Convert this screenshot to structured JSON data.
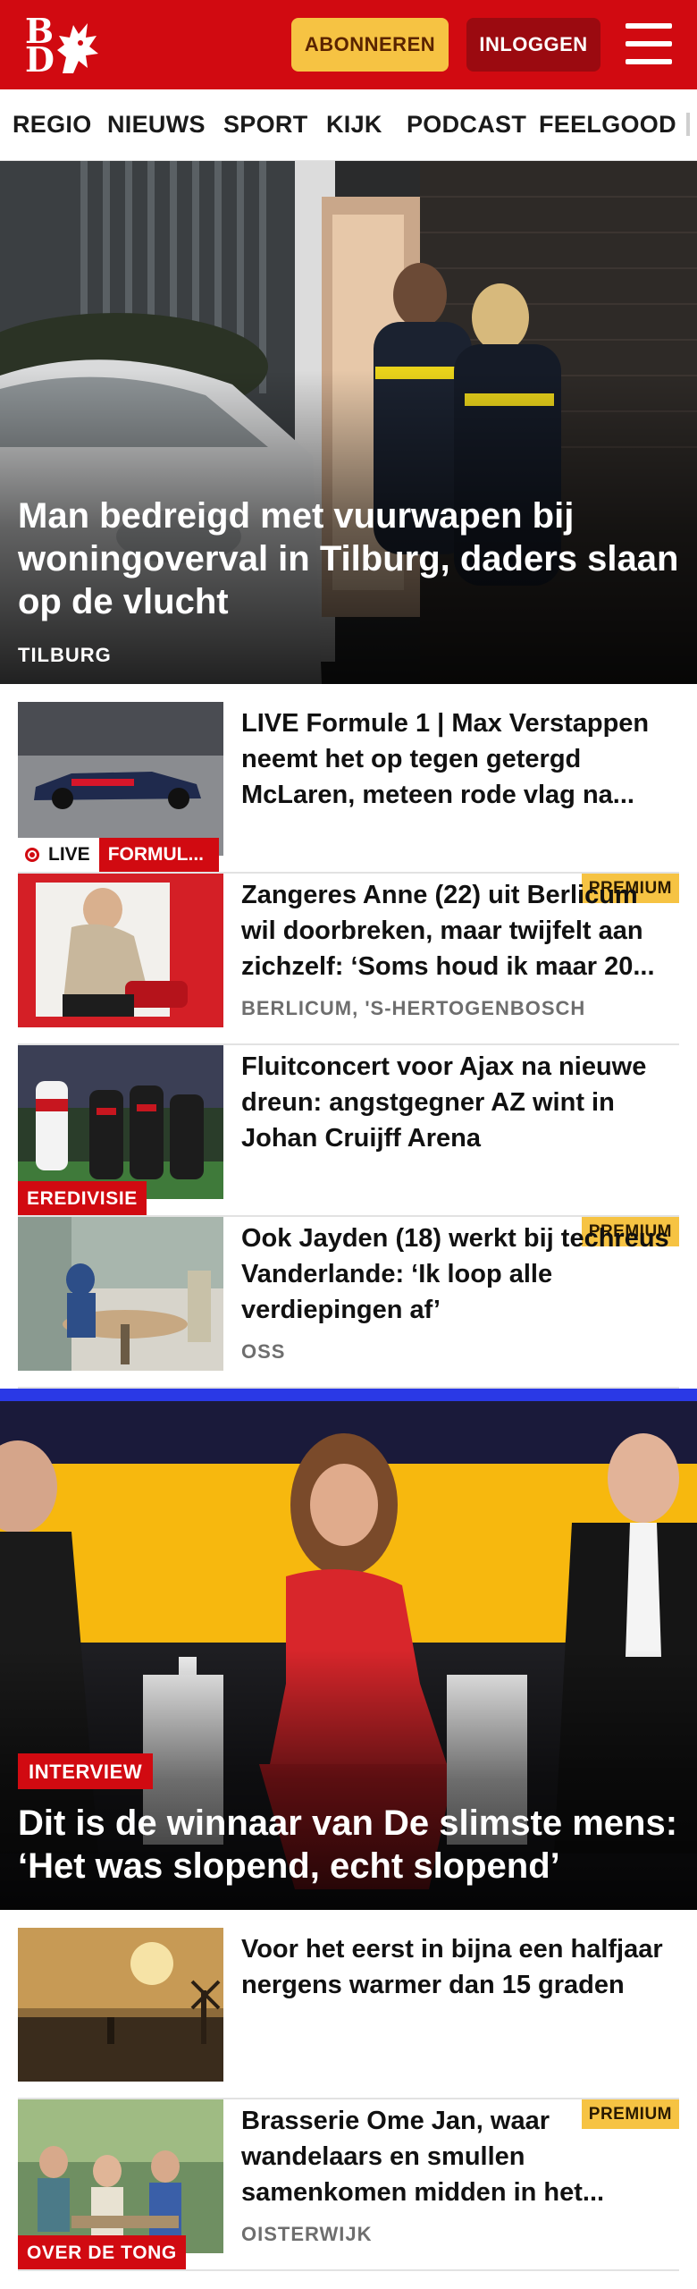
{
  "header": {
    "logo_text": "BD",
    "subscribe_label": "ABONNEREN",
    "login_label": "INLOGGEN",
    "menu_icon": "hamburger-menu-icon",
    "brand_color": "#d10a11"
  },
  "nav": {
    "items": [
      "REGIO",
      "NIEUWS",
      "SPORT",
      "KIJK",
      "PODCAST",
      "FEELGOOD"
    ]
  },
  "hero1": {
    "title": "Man bedreigd met vuurwapen bij woningoverval in Tilburg, daders slaan op de vlucht",
    "location": "TILBURG"
  },
  "articles": [
    {
      "title": "LIVE Formule 1 | Max Verstappen neemt het op tegen getergd McLaren, meteen rode vlag na...",
      "live_label": "LIVE",
      "category": "FORMUL..."
    },
    {
      "title": "Zangeres Anne (22) uit Berlicum wil doorbreken, maar twijfelt aan zichzelf: ‘Soms houd ik maar 20...",
      "premium": "PREMIUM",
      "location": "BERLICUM, 'S-HERTOGENBOSCH"
    },
    {
      "title": "Fluitconcert voor Ajax na nieuwe dreun: angstgegner AZ wint in Johan Cruijff Arena",
      "category": "EREDIVISIE"
    },
    {
      "title": "Ook Jayden (18) werkt bij techreus Vanderlande: ‘Ik loop alle verdiepingen af’",
      "premium": "PREMIUM",
      "location": "OSS"
    }
  ],
  "hero2": {
    "label": "INTERVIEW",
    "title": "Dit is de winnaar van De slimste mens: ‘Het was slopend, echt slopend’"
  },
  "articles2": [
    {
      "title": "Voor het eerst in bijna een halfjaar nergens warmer dan 15 graden"
    },
    {
      "title": "Brasserie Ome Jan, waar wandelaars en smullen samenkomen midden in het...",
      "premium": "PREMIUM",
      "category": "OVER DE TONG",
      "location": "OISTERWIJK"
    }
  ]
}
